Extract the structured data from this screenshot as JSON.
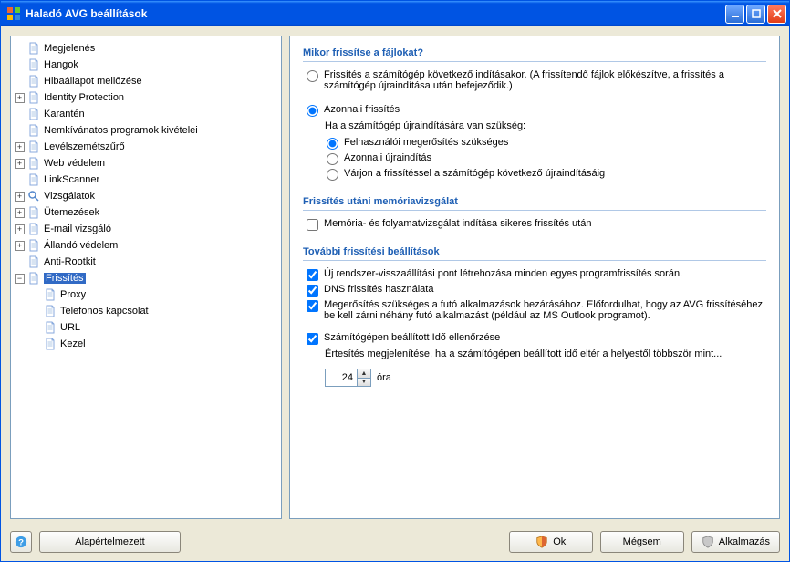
{
  "window": {
    "title": "Haladó AVG beállítások"
  },
  "tree": {
    "items": [
      {
        "label": "Megjelenés",
        "indent": 1,
        "expander": "blank"
      },
      {
        "label": "Hangok",
        "indent": 1,
        "expander": "blank"
      },
      {
        "label": "Hibaállapot mellőzése",
        "indent": 1,
        "expander": "blank"
      },
      {
        "label": "Identity Protection",
        "indent": 1,
        "expander": "plus"
      },
      {
        "label": "Karantén",
        "indent": 1,
        "expander": "blank"
      },
      {
        "label": "Nemkívánatos programok kivételei",
        "indent": 1,
        "expander": "blank"
      },
      {
        "label": "Levélszemétszűrő",
        "indent": 1,
        "expander": "plus"
      },
      {
        "label": "Web védelem",
        "indent": 1,
        "expander": "plus"
      },
      {
        "label": "LinkScanner",
        "indent": 1,
        "expander": "blank"
      },
      {
        "label": "Vizsgálatok",
        "indent": 1,
        "expander": "plus",
        "search": true
      },
      {
        "label": "Ütemezések",
        "indent": 1,
        "expander": "plus"
      },
      {
        "label": "E-mail vizsgáló",
        "indent": 1,
        "expander": "plus"
      },
      {
        "label": "Állandó védelem",
        "indent": 1,
        "expander": "plus"
      },
      {
        "label": "Anti-Rootkit",
        "indent": 1,
        "expander": "blank"
      },
      {
        "label": "Frissítés",
        "indent": 1,
        "expander": "minus",
        "selected": true
      },
      {
        "label": "Proxy",
        "indent": 2,
        "expander": "blank"
      },
      {
        "label": "Telefonos kapcsolat",
        "indent": 2,
        "expander": "blank"
      },
      {
        "label": "URL",
        "indent": 2,
        "expander": "blank"
      },
      {
        "label": "Kezel",
        "indent": 2,
        "expander": "blank"
      }
    ]
  },
  "panel": {
    "section1": {
      "title": "Mikor frissítse a fájlokat?",
      "opt_nextboot": "Frissítés a számítógép következő indításakor. (A frissítendő fájlok előkészítve, a frissítés a számítógép újraindítása után befejeződik.)",
      "opt_immediate": "Azonnali frissítés",
      "immediate_sub": "Ha a számítógép újraindítására van szükség:",
      "sub_confirm": "Felhasználói megerősítés szükséges",
      "sub_restart": "Azonnali újraindítás",
      "sub_wait": "Várjon a frissítéssel a számítógép következő újraindításáig"
    },
    "section2": {
      "title": "Frissítés utáni memóriavizsgálat",
      "check_memscan": "Memória- és folyamatvizsgálat indítása sikeres frissítés után"
    },
    "section3": {
      "title": "További frissítési beállítások",
      "check_restore": "Új rendszer-visszaállítási pont létrehozása minden egyes programfrissítés során.",
      "check_dns": "DNS frissítés használata",
      "check_close": "Megerősítés szükséges a futó alkalmazások bezárásához. Előfordulhat, hogy az AVG frissítéséhez be kell zárni néhány futó alkalmazást (például az MS Outlook programot).",
      "check_time": "Számítógépen beállított Idő ellenőrzése",
      "time_sub": "Értesítés megjelenítése, ha a számítógépen beállított idő eltér a helyestől többször mint...",
      "hours_value": "24",
      "hours_unit": "óra"
    }
  },
  "footer": {
    "default": "Alapértelmezett",
    "ok": "Ok",
    "cancel": "Mégsem",
    "apply": "Alkalmazás"
  }
}
